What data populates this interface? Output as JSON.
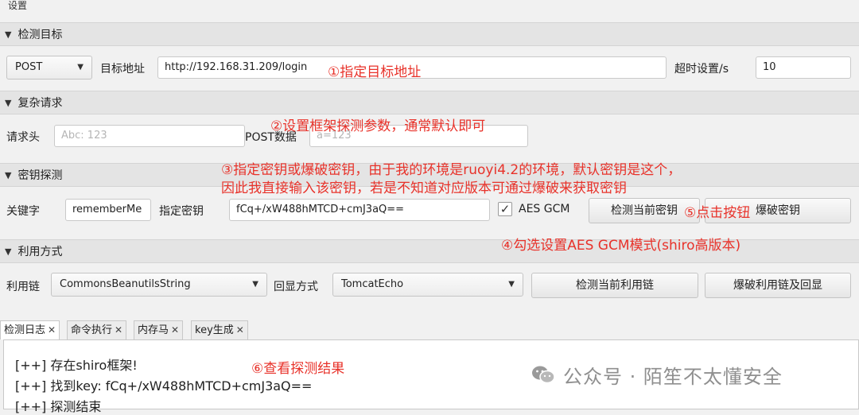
{
  "window": {
    "title": "设置"
  },
  "sections": {
    "target": "检测目标",
    "complex": "复杂请求",
    "key": "密钥探测",
    "exploit": "利用方式"
  },
  "target": {
    "method": "POST",
    "url_label": "目标地址",
    "url": "http://192.168.31.209/login",
    "timeout_label": "超时设置/s",
    "timeout": "10"
  },
  "complex": {
    "header_label": "请求头",
    "header_placeholder": "Abc: 123",
    "post_label": "POST数据",
    "post_placeholder": "a=123"
  },
  "keyprobe": {
    "keyword_label": "关键字",
    "keyword": "rememberMe",
    "key_label": "指定密钥",
    "key": "fCq+/xW488hMTCD+cmJ3aQ==",
    "aes_gcm_label": "AES GCM",
    "aes_gcm_checked": true,
    "detect_key_button": "检测当前密钥",
    "brute_key_button": "爆破密钥"
  },
  "exploit": {
    "chain_label": "利用链",
    "chain": "CommonsBeanutilsString",
    "echo_label": "回显方式",
    "echo": "TomcatEcho",
    "detect_chain_button": "检测当前利用链",
    "brute_chain_button": "爆破利用链及回显"
  },
  "tabs": [
    "检测日志",
    "命令执行",
    "内存马",
    "key生成"
  ],
  "log": {
    "line1": "[++] 存在shiro框架!",
    "line2": "[++] 找到key: fCq+/xW488hMTCD+cmJ3aQ==",
    "line3": "[++] 探测结束"
  },
  "annotations": {
    "a1": "①指定目标地址",
    "a2": "②设置框架探测参数，通常默认即可",
    "a3_line1": "③指定密钥或爆破密钥，由于我的环境是ruoyi4.2的环境，默认密钥是这个，",
    "a3_line2": "因此我直接输入该密钥，若是不知道对应版本可通过爆破来获取密钥",
    "a4": "④勾选设置AES GCM模式(shiro高版本)",
    "a5": "⑤点击按钮",
    "a6": "⑥查看探测结果"
  },
  "watermark": "公众号 · 陌笙不太懂安全",
  "colors": {
    "annotation": "#e8322a",
    "background": "#f1f1f1"
  }
}
